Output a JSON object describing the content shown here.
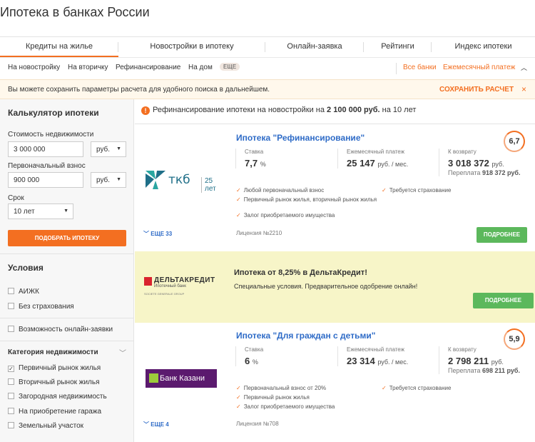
{
  "page": {
    "title": "Ипотека в банках России"
  },
  "main_tabs": [
    {
      "label": "Кредиты на жилье",
      "active": true
    },
    {
      "label": "Новостройки в ипотеку"
    },
    {
      "label": "Онлайн-заявка"
    },
    {
      "label": "Рейтинги"
    },
    {
      "label": "Индекс ипотеки"
    }
  ],
  "sub_tabs": {
    "items": [
      "На новостройку",
      "На вторичку",
      "Рефинансирование",
      "На дом"
    ],
    "more": "ЕЩЕ",
    "all_banks": "Все банки",
    "sort": "Ежемесячный платеж"
  },
  "notice": {
    "text": "Вы можете сохранить параметры расчета для удобного поиска в дальнейшем.",
    "save_label": "СОХРАНИТЬ РАСЧЕТ",
    "close": "×"
  },
  "calculator": {
    "title": "Калькулятор ипотеки",
    "property_cost_label": "Стоимость недвижимости",
    "property_cost_value": "3 000 000",
    "property_cost_currency": "руб.",
    "down_payment_label": "Первоначальный взнос",
    "down_payment_value": "900 000",
    "down_payment_currency": "руб.",
    "term_label": "Срок",
    "term_value": "10 лет",
    "button": "ПОДОБРАТЬ ИПОТЕКУ"
  },
  "conditions": {
    "title": "Условия",
    "items": [
      {
        "label": "АИЖК",
        "checked": false
      },
      {
        "label": "Без страхования",
        "checked": false
      }
    ],
    "online_label": "Возможность онлайн-заявки"
  },
  "category": {
    "title": "Категория недвижимости",
    "items": [
      {
        "label": "Первичный рынок жилья",
        "checked": true
      },
      {
        "label": "Вторичный рынок жилья",
        "checked": false
      },
      {
        "label": "Загородная недвижимость",
        "checked": false
      },
      {
        "label": "На приобретение гаража",
        "checked": false
      },
      {
        "label": "Земельный участок",
        "checked": false
      }
    ]
  },
  "info": {
    "prefix": "Рефинансирование ипотеки на новостройки на ",
    "amount": "2 100 000 руб.",
    "suffix": " на 10 лет"
  },
  "offers": [
    {
      "bank_logo_name": "ткб",
      "bank_logo_years": "25 лет",
      "title": "Ипотека \"Рефинансирование\"",
      "rate_label": "Ставка",
      "rate_value": "7,7",
      "rate_unit": "%",
      "monthly_label": "Ежемесячный платеж",
      "monthly_value": "25 147",
      "monthly_unit": "руб. / мес.",
      "total_label": "К возврату",
      "total_value": "3 018 372",
      "total_unit": "руб.",
      "overpay_label": "Переплата",
      "overpay_value": "918 372 руб.",
      "rating": "6,7",
      "features_left": [
        "Любой первоначальный взнос",
        "Первичный рынок жилья, вторичный рынок жилья",
        "Залог приобретаемого имущества"
      ],
      "features_right": [
        "Требуется страхование"
      ],
      "more": "ЕЩЕ 33",
      "license": "Лицензия №2210",
      "button": "ПОДРОБНЕЕ"
    },
    {
      "bank_logo_name": "Банк Казани",
      "title": "Ипотека \"Для граждан с детьми\"",
      "rate_label": "Ставка",
      "rate_value": "6",
      "rate_unit": "%",
      "monthly_label": "Ежемесячный платеж",
      "monthly_value": "23 314",
      "monthly_unit": "руб. / мес.",
      "total_label": "К возврату",
      "total_value": "2 798 211",
      "total_unit": "руб.",
      "overpay_label": "Переплата",
      "overpay_value": "698 211 руб.",
      "rating": "5,9",
      "features_left": [
        "Первоначальный взнос от 20%",
        "Первичный рынок жилья",
        "Залог приобретаемого имущества"
      ],
      "features_right": [
        "Требуется страхование"
      ],
      "more": "ЕЩЕ 4",
      "license": "Лицензия №708"
    }
  ],
  "ad": {
    "logo_name": "ДЕЛЬТАКРЕДИТ",
    "logo_sub": "Ипотечный банк",
    "logo_group": "SOCIETE GENERALE GROUP",
    "title": "Ипотека от 8,25% в ДельтаКредит!",
    "text": "Специальные условия. Предварительное одобрение онлайн!",
    "button": "ПОДРОБНЕЕ"
  },
  "colors": {
    "accent": "#f36f21",
    "link": "#2e6bc7",
    "button_green": "#5cb85c",
    "ad_bg": "#f7f5c8"
  }
}
